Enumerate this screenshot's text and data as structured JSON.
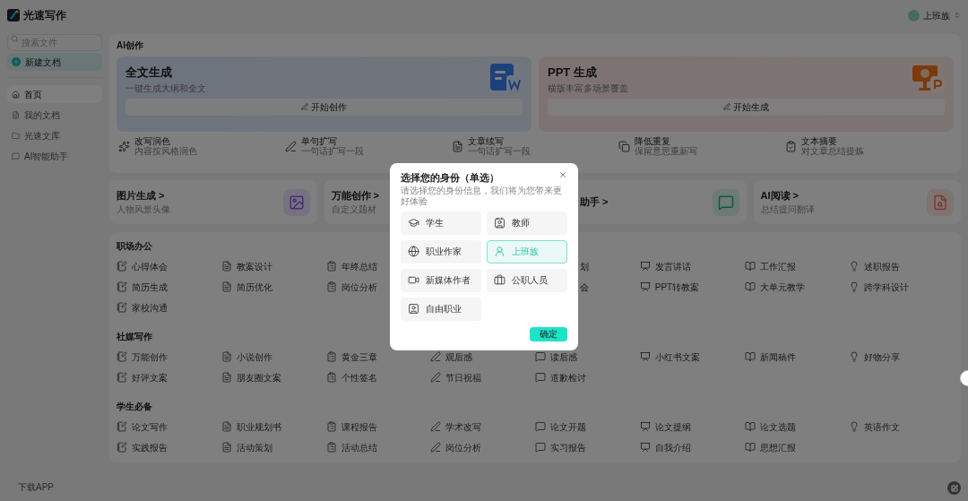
{
  "app": {
    "name": "光速写作"
  },
  "user": {
    "name": "上班族"
  },
  "sidebar": {
    "search_placeholder": "搜索文件",
    "new_button": "新建文档",
    "items": [
      {
        "label": "首页",
        "selected": true
      },
      {
        "label": "我的文档",
        "selected": false
      },
      {
        "label": "光速文库",
        "selected": false
      },
      {
        "label": "AI智能助手",
        "selected": false
      }
    ],
    "footer": "下载APP"
  },
  "ai_section": {
    "title": "AI创作",
    "hero_cards": [
      {
        "kind": "doc",
        "title": "全文生成",
        "subtitle": "一键生成大纲和全文",
        "button": "开始创作"
      },
      {
        "kind": "ppt",
        "title": "PPT 生成",
        "subtitle": "横版丰富多场景覆盖",
        "button": "开始生成"
      }
    ],
    "tools": [
      {
        "title": "改写润色",
        "subtitle": "内容按风格润色"
      },
      {
        "title": "单句扩写",
        "subtitle": "一句话扩写一段"
      },
      {
        "title": "文章续写",
        "subtitle": "一句话扩写一段"
      },
      {
        "title": "降低重复",
        "subtitle": "保留意思重新写"
      },
      {
        "title": "文本摘要",
        "subtitle": "对文章总结提炼"
      }
    ]
  },
  "feature_cards": [
    {
      "title": "图片生成 >",
      "subtitle": "人物风景头像",
      "kind": "image"
    },
    {
      "title": "万能创作 >",
      "subtitle": "自定义题材",
      "kind": "custom"
    },
    {
      "title": "助手 >",
      "kind": "chat"
    },
    {
      "title": "AI阅读 >",
      "subtitle": "总结提问翻译",
      "kind": "read"
    }
  ],
  "sections": [
    {
      "title": "职场办公",
      "items": [
        {
          "label": "心得体会"
        },
        {
          "label": "教案设计"
        },
        {
          "label": "年终总结"
        },
        {
          "kind": "hidden"
        },
        {
          "label": "划",
          "kind": "partial"
        },
        {
          "label": "发言讲话"
        },
        {
          "label": "工作汇报"
        },
        {
          "label": "述职报告"
        },
        {
          "label": "简历生成"
        },
        {
          "label": "简历优化"
        },
        {
          "label": "岗位分析"
        },
        {
          "kind": "hidden"
        },
        {
          "label": "会",
          "kind": "partial"
        },
        {
          "label": "PPT转教案"
        },
        {
          "label": "大单元教学"
        },
        {
          "label": "跨学科设计"
        },
        {
          "label": "家校沟通"
        }
      ]
    },
    {
      "title": "社媒写作",
      "items": [
        {
          "label": "万能创作"
        },
        {
          "label": "小说创作"
        },
        {
          "label": "黄金三章"
        },
        {
          "label": "观后感"
        },
        {
          "label": "读后感"
        },
        {
          "label": "小红书文案"
        },
        {
          "label": "新闻稿件"
        },
        {
          "label": "好物分享"
        },
        {
          "label": "好评文案"
        },
        {
          "label": "朋友圈文案"
        },
        {
          "label": "个性签名"
        },
        {
          "label": "节日祝福"
        },
        {
          "label": "道歉检讨"
        }
      ]
    },
    {
      "title": "学生必备",
      "items": [
        {
          "label": "论文写作"
        },
        {
          "label": "职业规划书"
        },
        {
          "label": "课程报告"
        },
        {
          "label": "学术改写"
        },
        {
          "label": "论文开题"
        },
        {
          "label": "论文提纲"
        },
        {
          "label": "论文选题"
        },
        {
          "label": "英语作文"
        },
        {
          "label": "实践报告"
        },
        {
          "label": "活动策划"
        },
        {
          "label": "活动总结"
        },
        {
          "label": "岗位分析"
        },
        {
          "label": "实习报告"
        },
        {
          "label": "自我介绍"
        },
        {
          "label": "思想汇报"
        }
      ]
    }
  ],
  "dialog": {
    "title": "选择您的身份（单选）",
    "subtitle": "请选择您的身份信息，我们将为您带来更好体验",
    "options": [
      {
        "label": "学生",
        "kind": "student",
        "selected": false
      },
      {
        "label": "教师",
        "kind": "teacher",
        "selected": false
      },
      {
        "label": "职业作家",
        "kind": "writer",
        "selected": false
      },
      {
        "label": "上班族",
        "kind": "office",
        "selected": true
      },
      {
        "label": "新媒体作者",
        "kind": "media",
        "selected": false
      },
      {
        "label": "公职人员",
        "kind": "civil",
        "selected": false
      },
      {
        "label": "自由职业",
        "kind": "freelance",
        "selected": false
      }
    ],
    "confirm": "确定"
  }
}
